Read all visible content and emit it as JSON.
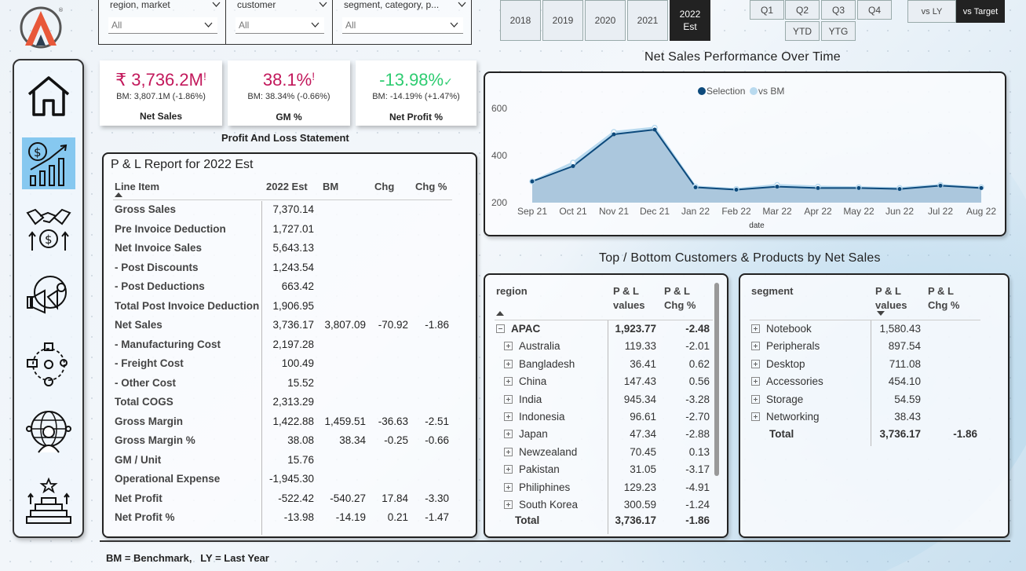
{
  "filters": {
    "region_market": {
      "label": "region, market",
      "value": "All"
    },
    "customer": {
      "label": "customer",
      "value": "All"
    },
    "segment_category": {
      "label": "segment, category, p...",
      "value": "All"
    }
  },
  "years": [
    "2018",
    "2019",
    "2020",
    "2021",
    "2022 Est"
  ],
  "active_year": "2022 Est",
  "quarters": [
    "Q1",
    "Q2",
    "Q3",
    "Q4"
  ],
  "periods": [
    "YTD",
    "YTG"
  ],
  "compare": {
    "vs_ly": "vs LY",
    "vs_target": "vs Target"
  },
  "kpis": {
    "net_sales": {
      "value": "₹ 3,736.2M",
      "flag": "!",
      "bm": "BM: 3,807.1M (-1.86%)",
      "label": "Net Sales",
      "color": "#c2185b"
    },
    "gm": {
      "value": "38.1%",
      "flag": "!",
      "bm": "BM: 38.34% (-0.66%)",
      "label": "GM %",
      "color": "#c2185b"
    },
    "net_profit": {
      "value": "-13.98%",
      "flag": "✓",
      "bm": "BM: -14.19% (+1.47%)",
      "label": "Net Profit %",
      "color": "#2ecc71"
    }
  },
  "pl_section_title": "Profit And Loss Statement",
  "pl": {
    "title": "P & L Report for 2022 Est",
    "headers": [
      "Line Item",
      "2022 Est",
      "BM",
      "Chg",
      "Chg %"
    ],
    "rows": [
      {
        "name": "Gross Sales",
        "est": "7,370.14",
        "bm": "",
        "chg": "",
        "chgp": ""
      },
      {
        "name": "Pre Invoice Deduction",
        "est": "1,727.01",
        "bm": "",
        "chg": "",
        "chgp": ""
      },
      {
        "name": "Net Invoice Sales",
        "est": "5,643.13",
        "bm": "",
        "chg": "",
        "chgp": ""
      },
      {
        "name": "- Post Discounts",
        "est": "1,243.54",
        "bm": "",
        "chg": "",
        "chgp": ""
      },
      {
        "name": "- Post Deductions",
        "est": "663.42",
        "bm": "",
        "chg": "",
        "chgp": ""
      },
      {
        "name": "Total Post Invoice Deduction",
        "est": "1,906.95",
        "bm": "",
        "chg": "",
        "chgp": ""
      },
      {
        "name": "Net Sales",
        "est": "3,736.17",
        "bm": "3,807.09",
        "chg": "-70.92",
        "chgp": "-1.86"
      },
      {
        "name": "- Manufacturing Cost",
        "est": "2,197.28",
        "bm": "",
        "chg": "",
        "chgp": ""
      },
      {
        "name": "- Freight Cost",
        "est": "100.49",
        "bm": "",
        "chg": "",
        "chgp": ""
      },
      {
        "name": "- Other Cost",
        "est": "15.52",
        "bm": "",
        "chg": "",
        "chgp": ""
      },
      {
        "name": "Total COGS",
        "est": "2,313.29",
        "bm": "",
        "chg": "",
        "chgp": ""
      },
      {
        "name": "Gross Margin",
        "est": "1,422.88",
        "bm": "1,459.51",
        "chg": "-36.63",
        "chgp": "-2.51"
      },
      {
        "name": "Gross Margin %",
        "est": "38.08",
        "bm": "38.34",
        "chg": "-0.25",
        "chgp": "-0.66"
      },
      {
        "name": "GM / Unit",
        "est": "15.76",
        "bm": "",
        "chg": "",
        "chgp": ""
      },
      {
        "name": "Operational Expense",
        "est": "-1,945.30",
        "bm": "",
        "chg": "",
        "chgp": ""
      },
      {
        "name": "Net Profit",
        "est": "-522.42",
        "bm": "-540.27",
        "chg": "17.84",
        "chgp": "-3.30"
      },
      {
        "name": "Net Profit %",
        "est": "-13.98",
        "bm": "-14.19",
        "chg": "0.21",
        "chgp": "-1.47"
      }
    ]
  },
  "chart_title": "Net Sales Performance Over Time",
  "chart_data": {
    "type": "area",
    "x": [
      "Sep 21",
      "Oct 21",
      "Nov 21",
      "Dec 21",
      "Jan 22",
      "Feb 22",
      "Mar 22",
      "Apr 22",
      "May 22",
      "Jun 22",
      "Jul 22",
      "Aug 22"
    ],
    "xlabel": "date",
    "ylabel": "",
    "ylim": [
      200,
      600
    ],
    "yticks": [
      200,
      400,
      600
    ],
    "legend": "top-center",
    "series": [
      {
        "name": "Selection",
        "values": [
          290,
          355,
          490,
          510,
          265,
          255,
          268,
          262,
          262,
          258,
          272,
          262
        ],
        "color": "#0d4a7c"
      },
      {
        "name": "vs BM",
        "values": [
          290,
          370,
          500,
          518,
          268,
          258,
          275,
          268,
          265,
          262,
          275,
          265
        ],
        "color": "#b9daef"
      }
    ]
  },
  "tb_title": "Top / Bottom Customers & Products by Net Sales",
  "region_table": {
    "headers": [
      "region",
      "P & L values",
      "P & L Chg %"
    ],
    "rows": [
      {
        "name": "APAC",
        "level": 0,
        "expand": "-",
        "v": "1,923.77",
        "c": "-2.48"
      },
      {
        "name": "Australia",
        "level": 1,
        "expand": "+",
        "v": "119.33",
        "c": "-2.01"
      },
      {
        "name": "Bangladesh",
        "level": 1,
        "expand": "+",
        "v": "36.41",
        "c": "0.62"
      },
      {
        "name": "China",
        "level": 1,
        "expand": "+",
        "v": "147.43",
        "c": "0.56"
      },
      {
        "name": "India",
        "level": 1,
        "expand": "+",
        "v": "945.34",
        "c": "-3.28"
      },
      {
        "name": "Indonesia",
        "level": 1,
        "expand": "+",
        "v": "96.61",
        "c": "-2.70"
      },
      {
        "name": "Japan",
        "level": 1,
        "expand": "+",
        "v": "47.34",
        "c": "-2.88"
      },
      {
        "name": "Newzealand",
        "level": 1,
        "expand": "+",
        "v": "70.45",
        "c": "0.13"
      },
      {
        "name": "Pakistan",
        "level": 1,
        "expand": "+",
        "v": "31.05",
        "c": "-3.17"
      },
      {
        "name": "Philiphines",
        "level": 1,
        "expand": "+",
        "v": "129.23",
        "c": "-4.91"
      },
      {
        "name": "South Korea",
        "level": 1,
        "expand": "+",
        "v": "300.59",
        "c": "-1.24"
      }
    ],
    "total": {
      "name": "Total",
      "v": "3,736.17",
      "c": "-1.86"
    }
  },
  "segment_table": {
    "headers": [
      "segment",
      "P & L values",
      "P & L Chg %"
    ],
    "rows": [
      {
        "name": "Notebook",
        "v": "1,580.43",
        "c": ""
      },
      {
        "name": "Peripherals",
        "v": "897.54",
        "c": ""
      },
      {
        "name": "Desktop",
        "v": "711.08",
        "c": ""
      },
      {
        "name": "Accessories",
        "v": "454.10",
        "c": ""
      },
      {
        "name": "Storage",
        "v": "54.59",
        "c": ""
      },
      {
        "name": "Networking",
        "v": "38.43",
        "c": ""
      }
    ],
    "total": {
      "name": "Total",
      "v": "3,736.17",
      "c": "-1.86"
    }
  },
  "footer": "BM = Benchmark,   LY = Last Year",
  "nav_icons": [
    "home-icon",
    "finance-growth-icon",
    "handshake-money-icon",
    "marketing-icon",
    "supply-chain-icon",
    "global-user-icon",
    "success-stairs-icon"
  ]
}
